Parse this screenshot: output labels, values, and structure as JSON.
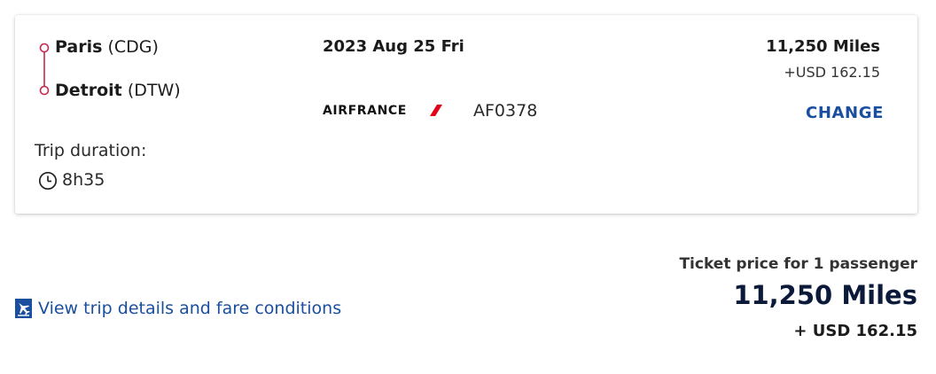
{
  "flight": {
    "origin": {
      "city": "Paris",
      "code": "(CDG)"
    },
    "destination": {
      "city": "Detroit",
      "code": "(DTW)"
    },
    "date": "2023 Aug 25 Fri",
    "airline_name": "AIRFRANCE",
    "flight_number": "AF0378",
    "trip_duration_label": "Trip duration:",
    "trip_duration_value": "8h35",
    "price_miles": "11,250 Miles",
    "price_usd": "+USD 162.15",
    "change_label": "CHANGE"
  },
  "footer": {
    "details_link": "View trip details and fare conditions",
    "price_caption": "Ticket price for 1 passenger",
    "total_miles": "11,250 Miles",
    "total_usd": "+ USD 162.15"
  },
  "icons": {
    "route": "route-line-icon",
    "clock": "clock-icon",
    "plane": "plane-icon",
    "airline_stripe": "air-france-stripe-logo"
  },
  "colors": {
    "route_accent": "#c8264b",
    "link_blue": "#1a4fa0",
    "brand_red": "#e2001a",
    "price_navy": "#0c1a3a"
  }
}
